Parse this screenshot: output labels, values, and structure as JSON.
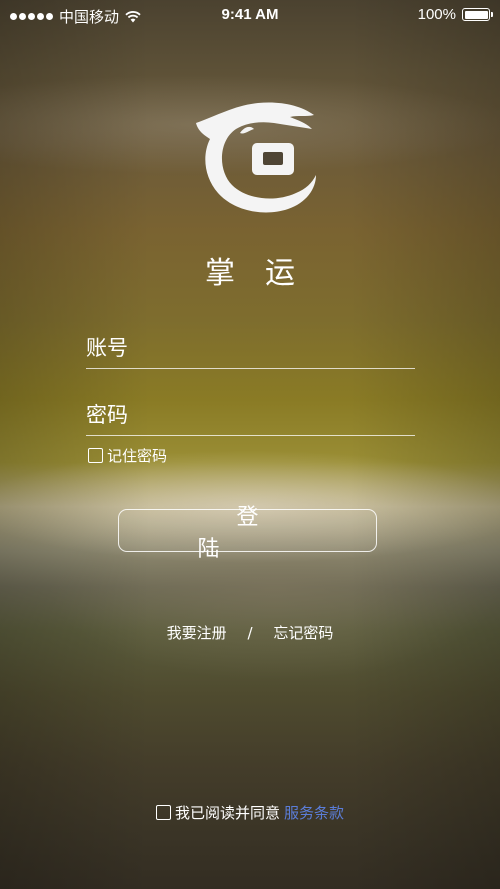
{
  "status_bar": {
    "carrier": "中国移动",
    "time": "9:41 AM",
    "battery": "100%"
  },
  "app": {
    "title": "掌运"
  },
  "form": {
    "account_placeholder": "账号",
    "password_placeholder": "密码",
    "remember_label": "记住密码",
    "login_label": "登陆"
  },
  "links": {
    "register": "我要注册",
    "separator": "/",
    "forgot": "忘记密码"
  },
  "agreement": {
    "text": "我已阅读并同意",
    "terms": "服务条款"
  },
  "colors": {
    "terms_link": "#5b7dd8",
    "text": "#ffffff"
  }
}
